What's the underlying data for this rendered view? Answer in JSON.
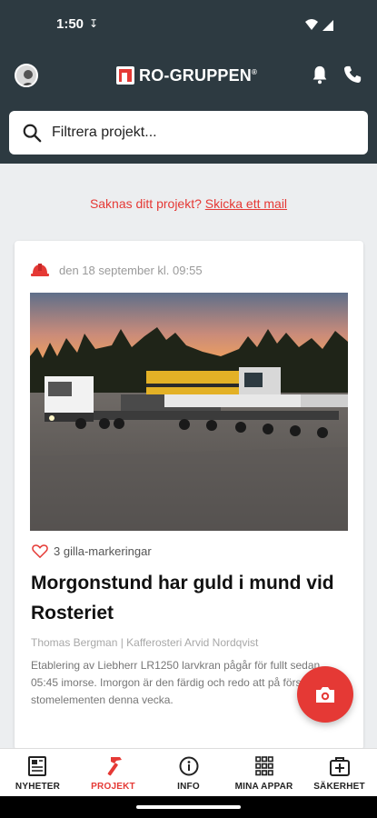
{
  "status": {
    "time": "1:50",
    "download_icon": "download-arrow-icon"
  },
  "header": {
    "logo_text": "RO-GRUPPEN",
    "logo_mark": "®",
    "search_placeholder": "Filtrera projekt..."
  },
  "missing_project": {
    "text": "Saknas ditt projekt? ",
    "link": "Skicka ett mail"
  },
  "post": {
    "date": "den 18 september kl. 09:55",
    "likes": "3 gilla-markeringar",
    "title": "Morgonstund har guld i mund vid Rosteriet",
    "author": "Thomas Bergman | Kafferosteri Arvid Nordqvist",
    "excerpt": "Etablering av Liebherr LR1250 larvkran pågår för fullt sedan 05:45 imorse. Imorgon är den färdig och redo att på första stomelementen denna vecka."
  },
  "nav": [
    {
      "label": "NYHETER",
      "icon": "newspaper-icon"
    },
    {
      "label": "PROJEKT",
      "icon": "hammer-icon"
    },
    {
      "label": "INFO",
      "icon": "info-icon"
    },
    {
      "label": "MINA APPAR",
      "icon": "grid-icon"
    },
    {
      "label": "SÄKERHET",
      "icon": "first-aid-icon"
    }
  ],
  "colors": {
    "header_bg": "#2d3a41",
    "accent": "#e53935",
    "page_bg": "#eceef0"
  }
}
